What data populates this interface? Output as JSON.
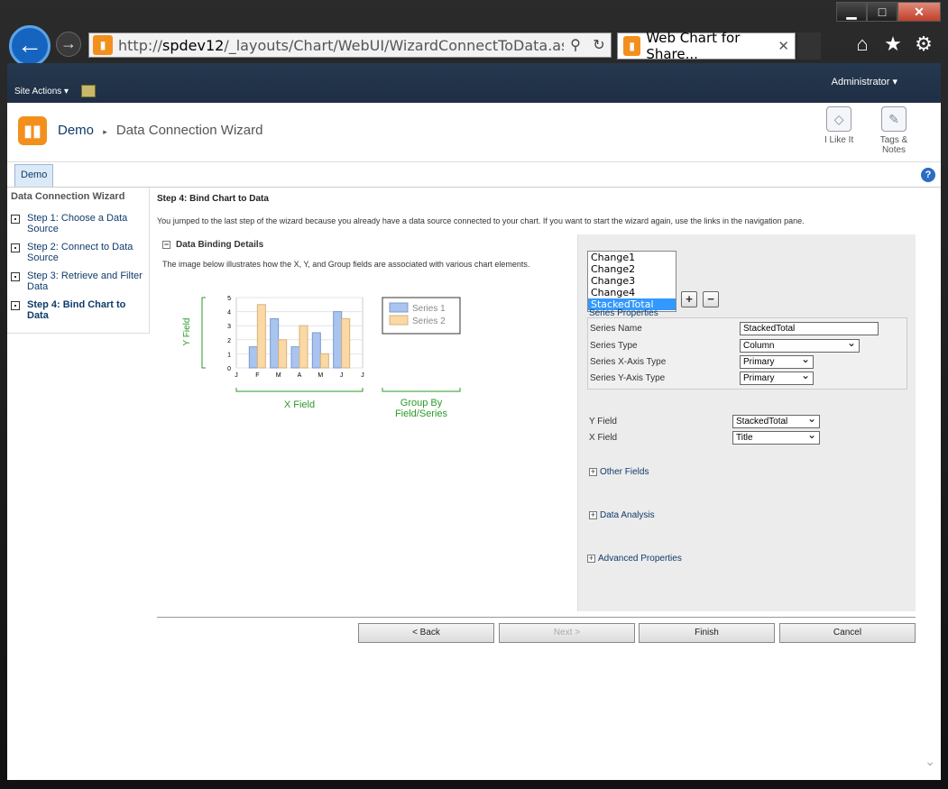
{
  "browser": {
    "url_prefix": "http://",
    "url_host": "spdev12",
    "url_rest": "/_layouts/Chart/WebUI/WizardConnectToData.aspx?skey",
    "tab_title": "Web Chart for Share...",
    "tab_close": "✕",
    "min": "▁",
    "max": "□",
    "close": "✕"
  },
  "ribbon": {
    "site_actions": "Site Actions ▾",
    "user": "Administrator ▾"
  },
  "title": {
    "site_link": "Demo",
    "separator": "▸",
    "page": "Data Connection Wizard",
    "like_label": "I Like It",
    "tags_label": "Tags & Notes"
  },
  "toptab": "Demo",
  "help": "?",
  "leftnav": {
    "heading": "Data Connection Wizard",
    "items": [
      {
        "label": "Step 1: Choose a Data Source"
      },
      {
        "label": "Step 2: Connect to Data Source"
      },
      {
        "label": "Step 3: Retrieve and Filter Data"
      },
      {
        "label": "Step 4: Bind Chart to Data"
      }
    ]
  },
  "main": {
    "step_title": "Step 4: Bind Chart to Data",
    "jumped": "You jumped to the last step of the wizard because you already have a data source connected to your chart. If you want to start the wizard again, use the links in the navigation pane.",
    "binding_heading": "Data Binding Details",
    "image_desc": "The image below illustrates how the X, Y, and Group fields are associated with various chart elements.",
    "y_field": "Y Field",
    "x_field": "X Field",
    "group_by": "Group By Field/Series",
    "legend": [
      "Series 1",
      "Series 2"
    ],
    "expand_minus": "−",
    "expand_plus": "+"
  },
  "chart_data": {
    "type": "bar",
    "categories": [
      "J",
      "F",
      "M",
      "A",
      "M",
      "J",
      "J"
    ],
    "series": [
      {
        "name": "Series 1",
        "values": [
          0,
          1.5,
          3.5,
          1.5,
          2.5,
          4,
          0
        ]
      },
      {
        "name": "Series 2",
        "values": [
          0,
          4.5,
          2,
          3,
          1,
          3.5,
          0
        ]
      }
    ],
    "yticks": [
      "0",
      "1",
      "2",
      "3",
      "4",
      "5"
    ],
    "ylim": [
      0,
      5
    ],
    "colors": {
      "s1": "#a9c4ef",
      "s2": "#fbd9a6"
    }
  },
  "right": {
    "series_list": [
      "Change1",
      "Change2",
      "Change3",
      "Change4",
      "StackedTotal"
    ],
    "series_selected": 4,
    "add": "+",
    "remove": "−",
    "series_properties": "Series Properties",
    "series_name_label": "Series Name",
    "series_name_value": "StackedTotal",
    "series_type_label": "Series Type",
    "series_type_value": "Column",
    "xaxis_label": "Series X-Axis Type",
    "xaxis_value": "Primary",
    "yaxis_label": "Series Y-Axis Type",
    "yaxis_value": "Primary",
    "y_field_label": "Y Field",
    "y_field_value": "StackedTotal",
    "x_field_label": "X Field",
    "x_field_value": "Title",
    "other_fields": "Other Fields",
    "data_analysis": "Data Analysis",
    "advanced": "Advanced Properties"
  },
  "buttons": {
    "back": "< Back",
    "next": "Next >",
    "finish": "Finish",
    "cancel": "Cancel"
  }
}
